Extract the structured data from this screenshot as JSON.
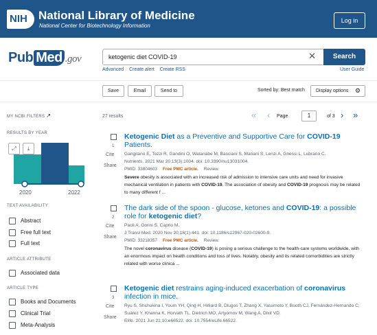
{
  "header": {
    "nih_logo": "NIH",
    "title": "National Library of Medicine",
    "subtitle": "National Center for Biotechnology Information",
    "login": "Log in"
  },
  "brand": {
    "pub": "Pub",
    "med": "Med",
    ".gov": ".gov"
  },
  "search": {
    "value": "ketogenic diet COVID-19",
    "clear_icon": "✕",
    "button": "Search"
  },
  "links": {
    "advanced": "Advanced",
    "create_alert": "Create alert",
    "create_rss": "Create RSS",
    "user_guide": "User Guide"
  },
  "toolbar": {
    "save": "Save",
    "email": "Email",
    "send_to": "Send to",
    "sorted_by": "Sorted by: Best match",
    "display_options": "Display options",
    "gear": "⚙"
  },
  "sidebar": {
    "my_ncbi": "MY NCBI FILTERS",
    "results_by_year": "RESULTS BY YEAR",
    "year_start": "2020",
    "year_end": "2022",
    "text_availability": "TEXT AVAILABILITY",
    "abstract": "Abstract",
    "free_full_text": "Free full text",
    "full_text": "Full text",
    "article_attribute": "ARTICLE ATTRIBUTE",
    "associated_data": "Associated data",
    "article_type": "ARTICLE TYPE",
    "books": "Books and Documents",
    "clinical_trial": "Clinical Trial",
    "meta_analysis": "Meta-Analysis"
  },
  "results": {
    "count": "27 results",
    "first": "«",
    "prev": "‹",
    "page_label": "Page",
    "page": "1",
    "of": "of 3",
    "next": "›",
    "last": "»"
  },
  "articles": [
    {
      "num": "1",
      "cite": "Cite",
      "share": "Share",
      "title_a": "Ketogenic Diet",
      "title_b": " as a Preventive and Supportive Care for ",
      "title_c": "COVID-19",
      "title_d": " Patients.",
      "authors": "Gangitano E, Tozzi R, Gandini O, Watanabe M, Basciani S, Mariani S, Lenzi A, Gnessi L, Lubrano C.",
      "journal": "Nutrients. 2021 Mar 20;13(3):1004. doi: 10.3390/nu13031004.",
      "pmid": "PMID: 33804603",
      "free": "Free PMC article.",
      "review": "Review.",
      "snippet": "Severe obesity is associated with an increased risk of admission to intensive care units and need for invasive mechanical ventilation in patients with COVID-19. The association of obesity and COVID-19 prognosis may be related to many different f ..."
    },
    {
      "num": "2",
      "cite": "Cite",
      "share": "Share",
      "title_a": "The dark side of the spoon - glucose, ketones and ",
      "title_b": "COVID-19",
      "title_c": ": a possible role for ",
      "title_d": "ketogenic diet",
      "title_e": "?",
      "authors": "Paoli A, Gorini S, Caprio M.",
      "journal": "J Transl Med. 2020 Nov 20;18(1):441. doi: 10.1186/s12967-020-02600-9.",
      "pmid": "PMID: 33218357",
      "free": "Free PMC article.",
      "review": "Review.",
      "snippet": "The novel coronavirus disease (COVID-19) is posing a serious challenge to the health-care systems worldwide, with an enormous impact on health conditions and loss of lives. Notably, obesity and its related comorbidities are strictly related with worse clinica ..."
    },
    {
      "num": "3",
      "cite": "Cite",
      "share": "Share",
      "title_a": "Ketogenic diet",
      "title_b": " restrains aging-induced exacerbation of ",
      "title_c": "coronavirus",
      "title_d": " infection in mice.",
      "authors": "Ryu S, Shchukina I, Youm YH, Qing H, Hilliard B, Dlugos T, Zhang X, Yasumoto Y, Booth CJ, Fernández-Hernando C, Suárez Y, Khanna K, Horvath TL, Dietrich MO, Artyomov M, Wang A, Dixit VD.",
      "journal": "Elife. 2021 Jun 21;10:e66522. doi: 10.7554/eLife.66522."
    }
  ],
  "colors": {
    "nih_blue": "#20558a",
    "link": "#0071bc",
    "free": "#c05600",
    "chart": "#20a5a5"
  }
}
